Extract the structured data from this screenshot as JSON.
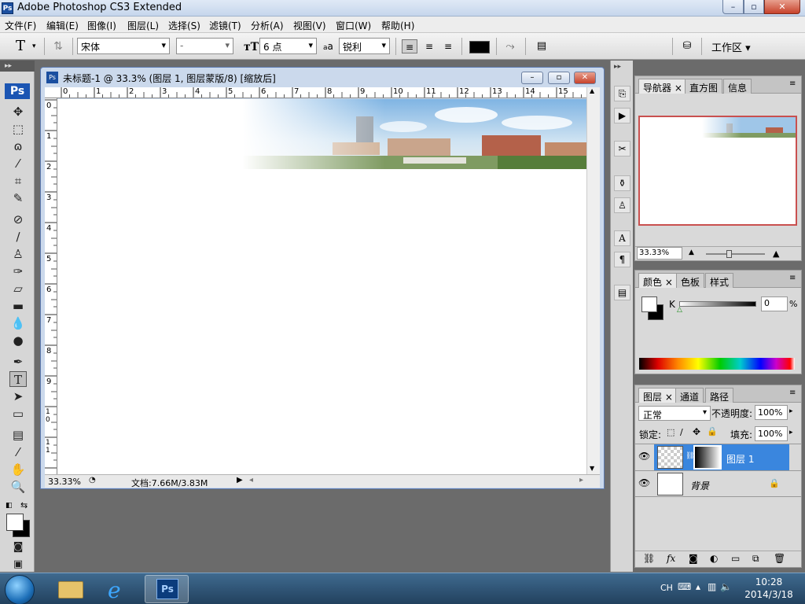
{
  "app": {
    "title": "Adobe Photoshop CS3 Extended",
    "logo": "Ps"
  },
  "window_controls": {
    "min": "–",
    "max": "▫",
    "close": "✕"
  },
  "menu": [
    "文件(F)",
    "编辑(E)",
    "图像(I)",
    "图层(L)",
    "选择(S)",
    "滤镜(T)",
    "分析(A)",
    "视图(V)",
    "窗口(W)",
    "帮助(H)"
  ],
  "options": {
    "tool_glyph": "T",
    "font_family": "宋体",
    "font_style": "-",
    "font_size": "6 点",
    "aa_label": "a",
    "aa_mode": "锐利",
    "workspace": "工作区 ▾"
  },
  "document": {
    "title": "未标题-1 @ 33.3% (图层 1, 图层蒙版/8) [缩放后]",
    "zoom": "33.33%",
    "doc_info": "文档:7.66M/3.83M",
    "ruler_h": [
      "0",
      "1",
      "2",
      "3",
      "4",
      "5",
      "6",
      "7",
      "8",
      "9",
      "10",
      "11",
      "12",
      "13",
      "14",
      "15"
    ],
    "ruler_v": [
      "0",
      "1",
      "2",
      "3",
      "4",
      "5",
      "6",
      "7",
      "8",
      "9",
      "10",
      "11"
    ]
  },
  "navigator": {
    "tabs": [
      "导航器 ×",
      "直方图",
      "信息"
    ],
    "zoom": "33.33%",
    "accent": "#c9504f"
  },
  "color_panel": {
    "tabs": [
      "颜色 ×",
      "色板",
      "样式"
    ],
    "channel": "K",
    "value": "0",
    "unit": "%"
  },
  "layers_panel": {
    "tabs": [
      "图层 ×",
      "通道",
      "路径"
    ],
    "blend_mode": "正常",
    "opacity_label": "不透明度:",
    "opacity": "100%",
    "lock_label": "锁定:",
    "fill_label": "填充:",
    "fill": "100%",
    "layers": [
      {
        "name": "图层 1",
        "selected": true
      },
      {
        "name": "背景",
        "selected": false
      }
    ],
    "selection_color": "#3a86de"
  },
  "taskbar": {
    "lang": "CH",
    "time": "10:28",
    "date": "2014/3/18",
    "ps_label": "Ps"
  }
}
